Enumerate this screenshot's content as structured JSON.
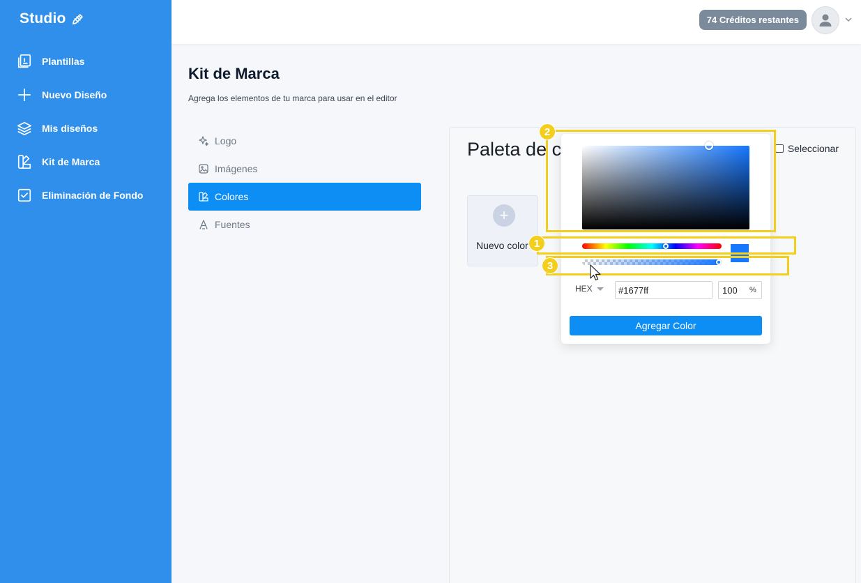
{
  "brand": {
    "name": "Studio"
  },
  "sidebar": {
    "items": [
      {
        "label": "Plantillas",
        "icon": "templates-icon"
      },
      {
        "label": "Nuevo Diseño",
        "icon": "plus-icon"
      },
      {
        "label": "Mis diseños",
        "icon": "layers-icon"
      },
      {
        "label": "Kit de Marca",
        "icon": "brand-kit-icon"
      },
      {
        "label": "Eliminación de Fondo",
        "icon": "checkbox-icon"
      }
    ]
  },
  "header": {
    "credits": "74 Créditos restantes"
  },
  "page": {
    "title": "Kit de Marca",
    "subtitle": "Agrega los elementos de tu marca para usar en el editor"
  },
  "submenu": {
    "items": [
      {
        "label": "Logo",
        "active": false
      },
      {
        "label": "Imágenes",
        "active": false
      },
      {
        "label": "Colores",
        "active": true
      },
      {
        "label": "Fuentes",
        "active": false
      }
    ]
  },
  "panel": {
    "title": "Paleta de c",
    "select_label": "Seleccionar",
    "new_color_label": "Nuevo color"
  },
  "picker": {
    "format": "HEX",
    "hex_value": "#1677ff",
    "alpha_value": "100",
    "alpha_unit": "%",
    "add_button": "Agregar Color",
    "color": "#1677ff",
    "hue_position": 0.6,
    "alpha_position": 1.0,
    "saturation": 0.76,
    "brightness": 1.0
  },
  "annotations": [
    {
      "number": "1"
    },
    {
      "number": "2"
    },
    {
      "number": "3"
    }
  ],
  "colors": {
    "sidebar": "#2f8fea",
    "accent": "#0d8ef5",
    "highlight": "#f3ce1d",
    "credits_badge": "#7c8b9b"
  }
}
